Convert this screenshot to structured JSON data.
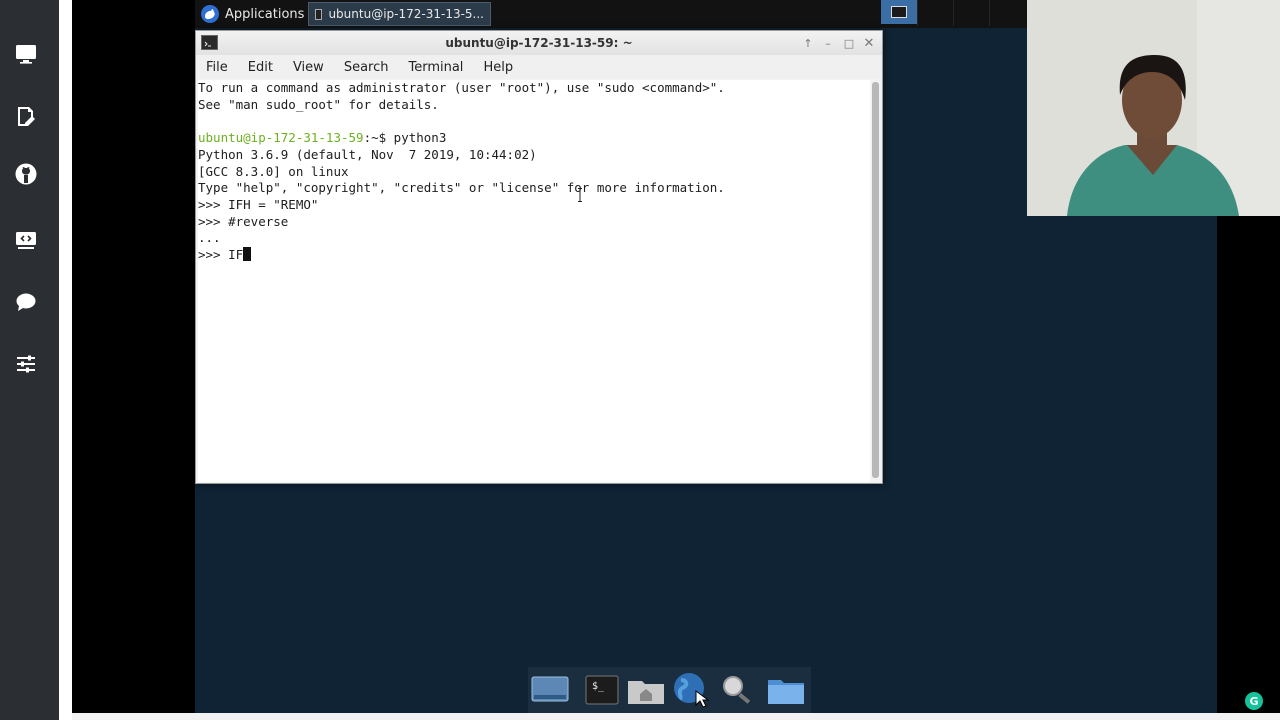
{
  "left_nav": {
    "icons": [
      "monitor-icon",
      "edit-document-icon",
      "github-icon",
      "code-screen-icon",
      "chat-bubble-icon",
      "sliders-icon"
    ]
  },
  "top_panel": {
    "applications_label": "Applications",
    "task_label": "ubuntu@ip-172-31-13-5..."
  },
  "terminal": {
    "title": "ubuntu@ip-172-31-13-59: ~",
    "menu": [
      "File",
      "Edit",
      "View",
      "Search",
      "Terminal",
      "Help"
    ],
    "lines": {
      "l1": "To run a command as administrator (user \"root\"), use \"sudo <command>\".",
      "l2": "See \"man sudo_root\" for details.",
      "l3_user": "ubuntu@ip-172-31-13-59",
      "l3_rest": ":~$ python3",
      "l4": "Python 3.6.9 (default, Nov  7 2019, 10:44:02)",
      "l5": "[GCC 8.3.0] on linux",
      "l6": "Type \"help\", \"copyright\", \"credits\" or \"license\" for more information.",
      "l7": ">>> IFH = \"REMO\"",
      "l8": ">>> #reverse",
      "l9": "...",
      "l10": ">>> IF"
    }
  },
  "dock": {
    "items": [
      "show-desktop-icon",
      "terminal-icon",
      "home-folder-icon",
      "web-browser-icon",
      "search-icon",
      "files-icon"
    ]
  },
  "colors": {
    "desktop": "#0f2334",
    "nav": "#2b2f33",
    "prompt_user": "#6cb021",
    "grammarly": "#15c39a"
  }
}
